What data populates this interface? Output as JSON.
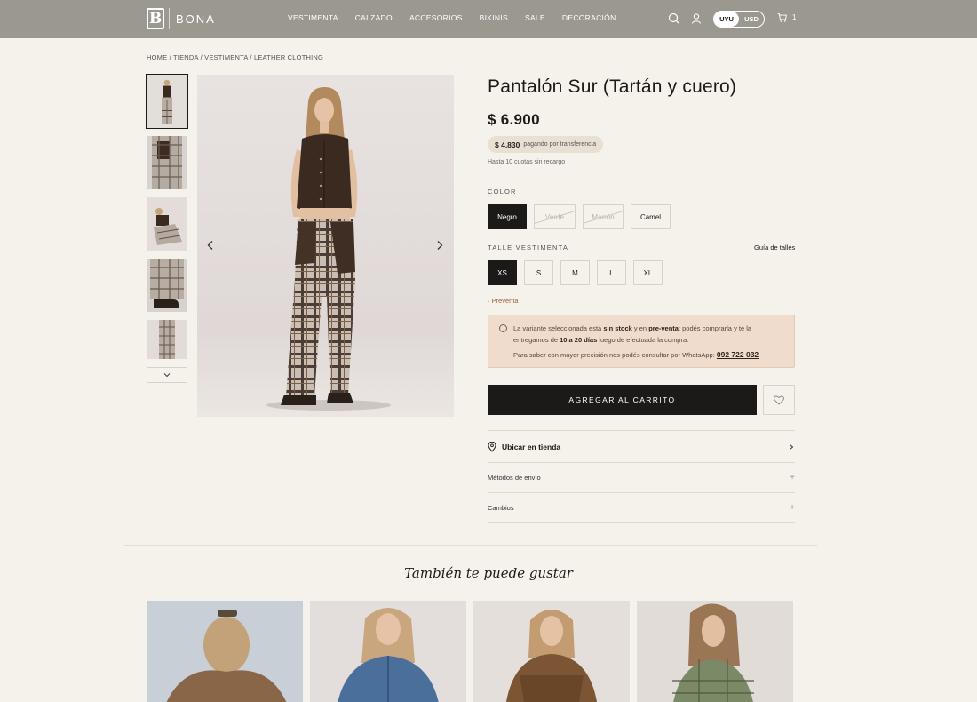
{
  "header": {
    "brand": "BONA",
    "nav": [
      "VESTIMENTA",
      "CALZADO",
      "ACCESORIOS",
      "BIKINIS",
      "SALE",
      "DECORACIÓN"
    ],
    "currency": [
      "UYU",
      "USD"
    ],
    "currency_selected": "UYU",
    "cart_count": "1",
    "icons": [
      "search-icon",
      "user-icon",
      "cart-icon"
    ]
  },
  "breadcrumb": "HOME / TIENDA / VESTIMENTA / LEATHER CLOTHING",
  "product": {
    "title": "Pantalón Sur (Tartán y cuero)",
    "price": "$ 6.900",
    "transfer_price": "$ 4.830",
    "transfer_note": "pagando por transferencia",
    "installments": "Hasta 10 cuotas sin recargo",
    "color_label": "COLOR",
    "colors": [
      {
        "label": "Negro",
        "state": "selected"
      },
      {
        "label": "Verde",
        "state": "disabled"
      },
      {
        "label": "Marrón",
        "state": "disabled"
      },
      {
        "label": "Camel",
        "state": "available"
      }
    ],
    "size_label": "TALLE VESTIMENTA",
    "size_guide": "Guía de talles",
    "sizes": [
      {
        "label": "XS",
        "state": "selected"
      },
      {
        "label": "S",
        "state": "available"
      },
      {
        "label": "M",
        "state": "available"
      },
      {
        "label": "L",
        "state": "available"
      },
      {
        "label": "XL",
        "state": "available"
      }
    ],
    "preventa": "· Preventa",
    "notice": {
      "l1_a": "La variante seleccionada está ",
      "l1_b": "sin stock",
      "l1_c": " y en ",
      "l1_d": "pre-venta",
      "l1_e": ": podés comprarla y te la",
      "l2_a": "entregamos de ",
      "l2_b": "10 a 20 días",
      "l2_c": " luego de efectuada la compra.",
      "l3": "Para saber con mayor precisión nos podés consultar por WhatsApp: ",
      "phone": "092 722 032"
    },
    "add_to_cart": "AGREGAR AL CARRITO",
    "accordions": [
      "Ubicar en tienda",
      "Métodos de envío",
      "Cambios"
    ]
  },
  "related_title": "También te puede gustar",
  "colors": {
    "dark": "#1c1a18",
    "header_bg": "#9b9890",
    "page_bg": "#f5f1eb",
    "notice_bg": "#f0dccd"
  }
}
